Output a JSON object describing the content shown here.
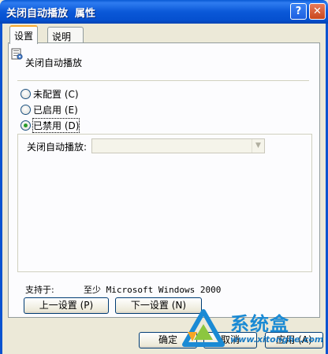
{
  "window": {
    "title": "关闭自动播放  属性",
    "help_glyph": "?",
    "close_glyph": "✕"
  },
  "tabs": [
    {
      "label": "设置",
      "active": true
    },
    {
      "label": "说明",
      "active": false
    }
  ],
  "policy": {
    "name": "关闭自动播放",
    "icon": "policy-setting-icon"
  },
  "options": [
    {
      "label": "未配置 (C)",
      "checked": false
    },
    {
      "label": "已启用 (E)",
      "checked": false
    },
    {
      "label": "已禁用 (D)",
      "checked": true
    }
  ],
  "setting": {
    "label": "关闭自动播放:",
    "value": ""
  },
  "support": {
    "label": "支持于:",
    "value": "至少 Microsoft Windows 2000"
  },
  "buttons": {
    "prev": "上一设置 (P)",
    "next": "下一设置 (N)",
    "ok": "确定",
    "cancel": "取消",
    "apply": "应用 (A)"
  },
  "watermark": {
    "brand": "系统盒",
    "url": "www.xitonghe.com"
  },
  "colors": {
    "titlebar": "#0a58d8",
    "dialog_bg": "#ece9d8",
    "tab_accent": "#f8a82c",
    "watermark": "#1a8ad4"
  }
}
